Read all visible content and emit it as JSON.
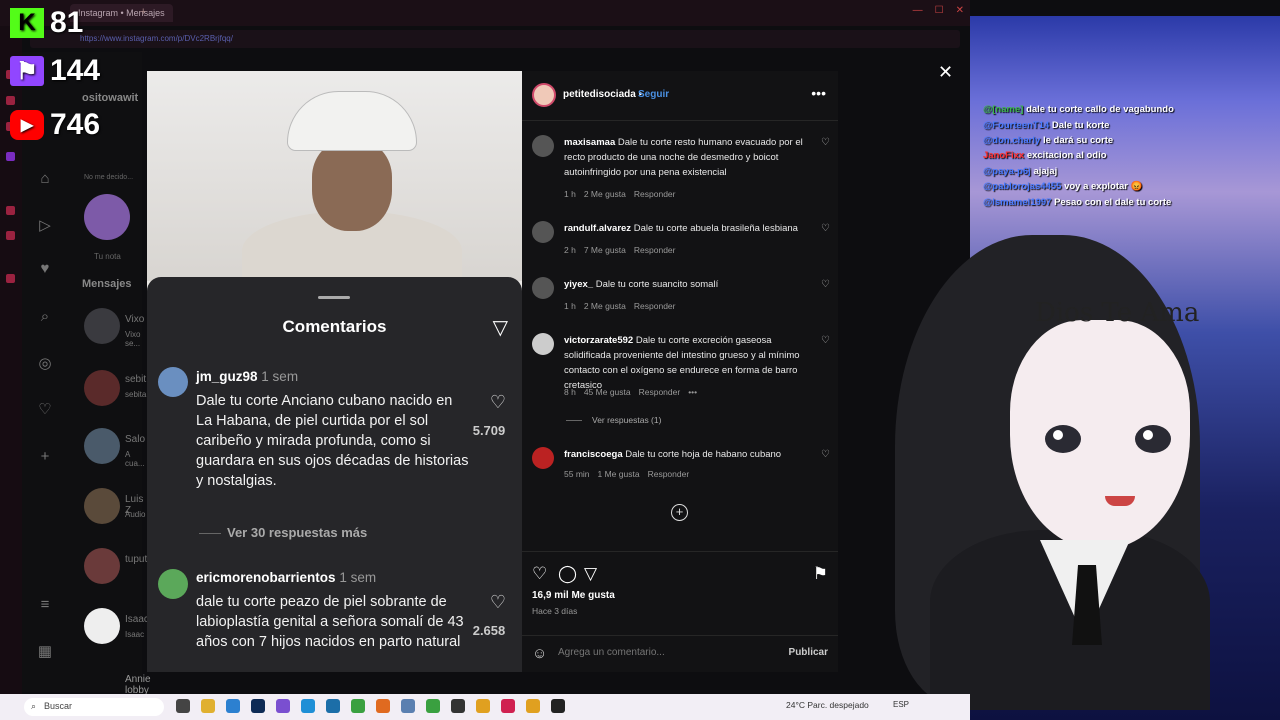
{
  "browser": {
    "tab_label": "Instagram • Mensajes",
    "url": "https://www.instagram.com/p/DVc2RBrjfqq/"
  },
  "stats": {
    "kick": "81",
    "twitch": "144",
    "youtube": "746"
  },
  "ig_nav": {
    "messages_label": "Mensajes",
    "note_label": "Tu nota",
    "note_placeholder": "No me decido...",
    "user_header": "ositowawit",
    "conversations": [
      {
        "name": "Vixo",
        "preview": "Vixo se..."
      },
      {
        "name": "sebit",
        "preview": "sebita..."
      },
      {
        "name": "Salo",
        "preview": "A cua..."
      },
      {
        "name": "Luis Z",
        "preview": "Audio"
      },
      {
        "name": "tuput",
        "preview": ""
      },
      {
        "name": "Isaac",
        "preview": "Isaac"
      },
      {
        "name": "Annie lobby",
        "preview": ""
      }
    ]
  },
  "sheet": {
    "title": "Comentarios",
    "comments": [
      {
        "user": "jm_guz98",
        "time": "1 sem",
        "text": "Dale tu corte Anciano cubano nacido en La Habana, de piel curtida por el sol caribeño y mirada profunda, como si guardara en sus ojos décadas de historias y nostalgias.",
        "likes": "5.709",
        "replies": "Ver 30 respuestas más"
      },
      {
        "user": "ericmorenobarrientos",
        "time": "1 sem",
        "text": "dale tu corte peazo de piel sobrante de labioplastía genital a señora somalí de 43 años con 7 hijos nacidos en parto natural",
        "likes": "2.658"
      }
    ]
  },
  "post": {
    "author": "petitedisociada",
    "follow_label": "Seguir",
    "likes": "16,9 mil Me gusta",
    "date": "Hace 3 días",
    "comment_placeholder": "Agrega un comentario...",
    "publish_label": "Publicar",
    "comments": [
      {
        "user": "maxisamaa",
        "text": "Dale tu corte resto humano evacuado por el recto producto de una noche de desmedro y boicot autoinfringido por una pena existencial",
        "time": "1 h",
        "likes": "2 Me gusta",
        "reply": "Responder"
      },
      {
        "user": "randulf.alvarez",
        "text": "Dale tu corte abuela brasileña lesbiana",
        "time": "2 h",
        "likes": "7 Me gusta",
        "reply": "Responder"
      },
      {
        "user": "yiyex_",
        "text": "Dale tu corte suancito somalí",
        "time": "1 h",
        "likes": "2 Me gusta",
        "reply": "Responder"
      },
      {
        "user": "victorzarate592",
        "text": "Dale tu corte excreción gaseosa solidificada proveniente del intestino grueso y al mínimo contacto con el oxígeno se endurece en forma de barro cretasico",
        "time": "8 h",
        "likes": "45 Me gusta",
        "reply": "Responder",
        "view_replies": "Ver respuestas (1)"
      },
      {
        "user": "franciscoega",
        "text": "Dale tu corte hoja de habano cubano",
        "time": "55 min",
        "likes": "1 Me gusta",
        "reply": "Responder"
      }
    ]
  },
  "chat": [
    {
      "user": "@[name]",
      "msg": "dale tu corte callo de vagabundo",
      "color": "#3bb54a"
    },
    {
      "user": "@FourteenT14",
      "msg": "Dale tu korte",
      "color": "#4a7bff"
    },
    {
      "user": "@don.charly",
      "msg": "le dará su corte",
      "color": "#4a7bff"
    },
    {
      "user": "JanoFixx",
      "msg": "excitacion al odio",
      "color": "#ff3030"
    },
    {
      "user": "@paya-p6j",
      "msg": "ajajaj",
      "color": "#4a7bff"
    },
    {
      "user": "@pablorojas4455",
      "msg": "voy a explotar 😡",
      "color": "#4a7bff"
    },
    {
      "user": "@Ismamel1997",
      "msg": "Pesao con el dale tu corte",
      "color": "#4a7bff"
    }
  ],
  "overlay": {
    "dios_text": "Dios Te Ama"
  },
  "taskbar": {
    "search_label": "Buscar",
    "weather": "24°C  Parc. despejado",
    "lang": "ESP"
  }
}
